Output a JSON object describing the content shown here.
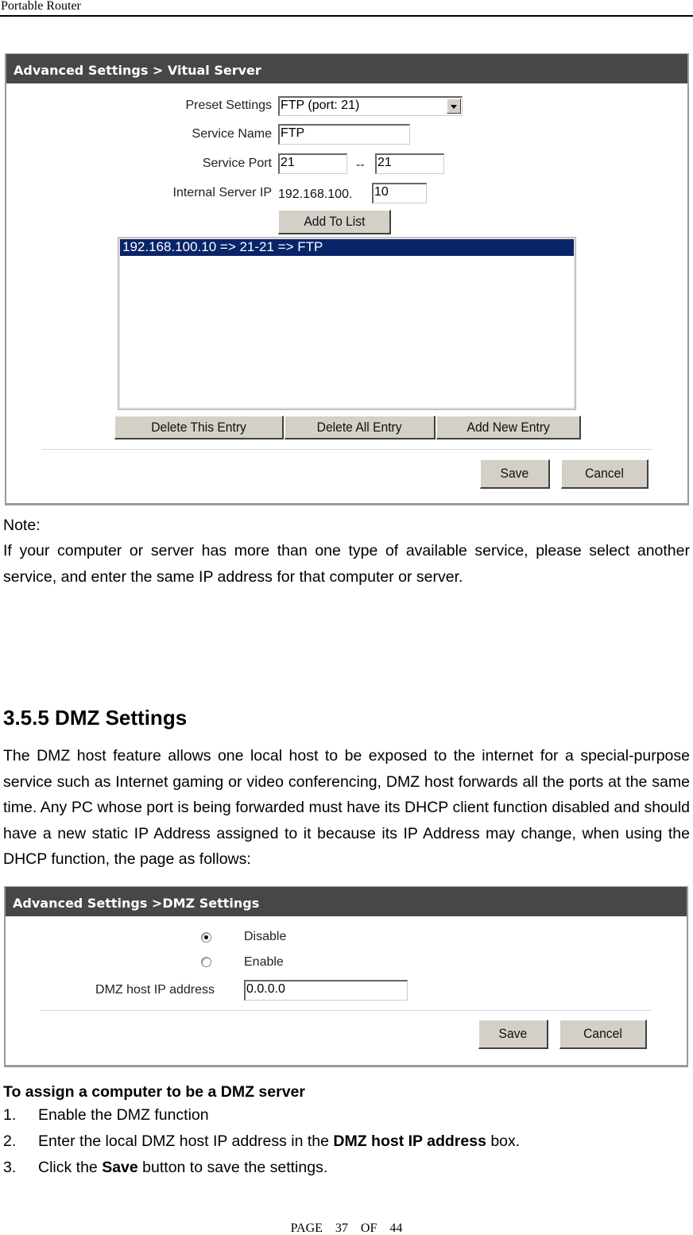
{
  "page_header": "Portable Router",
  "vs_panel": {
    "title": "Advanced Settings > Vitual Server",
    "preset_label": "Preset Settings",
    "preset_value": "FTP (port: 21)",
    "service_name_label": "Service Name",
    "service_name_value": "FTP",
    "service_port_label": "Service Port",
    "port_start": "21",
    "port_sep": "--",
    "port_end": "21",
    "internal_ip_label": "Internal Server IP",
    "ip_prefix": "192.168.100.",
    "ip_suffix": "10",
    "add_button": "Add To List",
    "list_items": [
      "192.168.100.10 => 21-21 => FTP"
    ],
    "delete_this": "Delete This Entry",
    "delete_all": "Delete All Entry",
    "add_new": "Add New Entry",
    "save": "Save",
    "cancel": "Cancel"
  },
  "note": {
    "label": "Note:",
    "text": "If your computer or server has more than one type of available service, please select another service, and enter the same IP address for that computer or server."
  },
  "section": {
    "heading": "3.5.5 DMZ Settings",
    "paragraph": "The DMZ host feature allows one local host to be exposed to the internet for a special-purpose service such as Internet gaming or video conferencing, DMZ host forwards all the ports at the same time. Any PC whose port is being forwarded must have its DHCP client function disabled and should have a new static IP Address assigned to it because its IP Address may change, when using the DHCP function, the page as follows:"
  },
  "dmz_panel": {
    "title": "Advanced Settings >DMZ Settings",
    "disable_label": "Disable",
    "enable_label": "Enable",
    "selected": "Disable",
    "host_ip_label": "DMZ host IP address",
    "host_ip_value": "0.0.0.0",
    "save": "Save",
    "cancel": "Cancel"
  },
  "instructions": {
    "title": "To assign a computer to be a DMZ server",
    "steps": [
      {
        "num": "1.",
        "pre": "Enable the DMZ function",
        "bold": "",
        "post": ""
      },
      {
        "num": "2.",
        "pre": "Enter the local DMZ host IP address in the ",
        "bold": "DMZ host IP address",
        "post": " box."
      },
      {
        "num": "3.",
        "pre": "Click the ",
        "bold": "Save",
        "post": " button to save the settings."
      }
    ]
  },
  "footer": "PAGE 37 OF 44",
  "colors": {
    "panel_header_bg": "#474747",
    "list_selected_bg": "#0a246a",
    "button_bg": "#d4d0c8"
  }
}
